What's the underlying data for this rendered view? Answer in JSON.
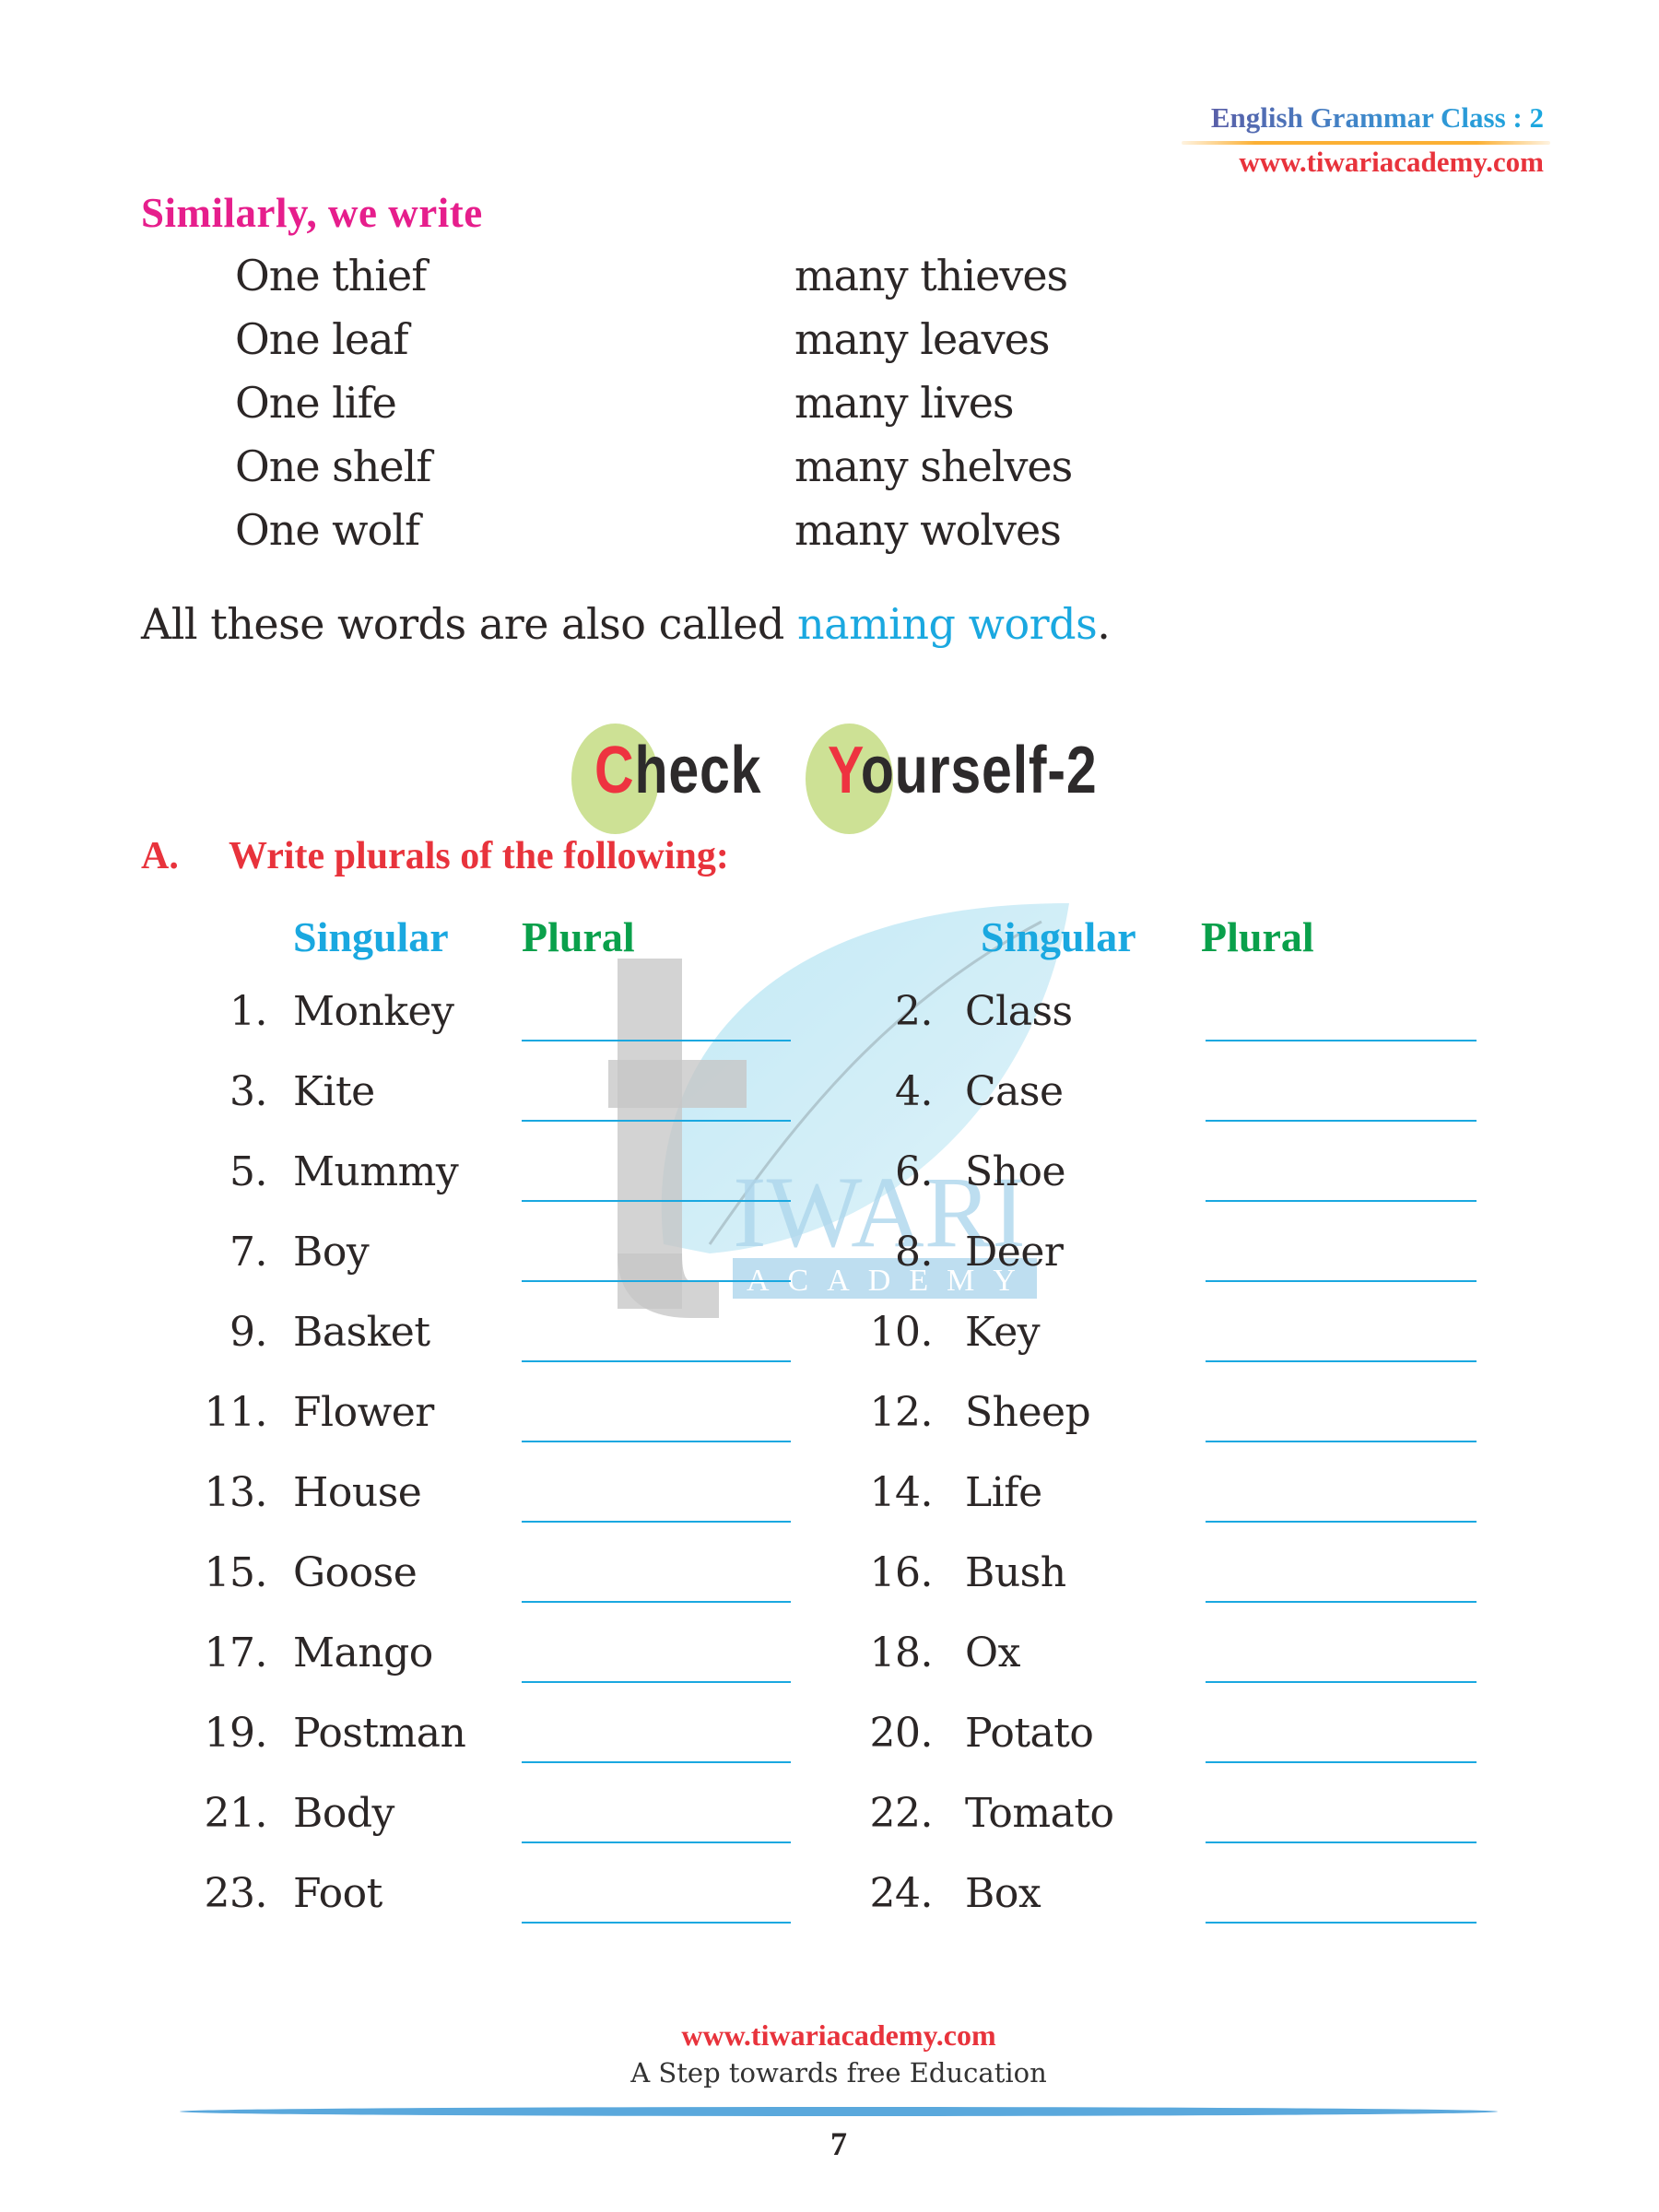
{
  "header": {
    "title": "English Grammar Class : 2",
    "url": "www.tiwariacademy.com"
  },
  "similarly": {
    "heading": "Similarly, we write",
    "pairs": [
      {
        "singular": "One thief",
        "plural": "many thieves"
      },
      {
        "singular": "One leaf",
        "plural": "many leaves"
      },
      {
        "singular": "One life",
        "plural": "many lives"
      },
      {
        "singular": "One shelf",
        "plural": "many shelves"
      },
      {
        "singular": "One wolf",
        "plural": "many wolves"
      }
    ],
    "note_prefix": "All these words are also called ",
    "note_highlight": "naming words",
    "note_suffix": "."
  },
  "check_yourself": {
    "title_c": "C",
    "title_rest1": "heck",
    "title_y": "Y",
    "title_rest2": "ourself-2"
  },
  "exercise": {
    "label": "A.",
    "instruction": "Write plurals of the following:",
    "col_singular": "Singular",
    "col_plural": "Plural",
    "left_items": [
      {
        "num": "1.",
        "word": "Monkey"
      },
      {
        "num": "3.",
        "word": "Kite"
      },
      {
        "num": "5.",
        "word": "Mummy"
      },
      {
        "num": "7.",
        "word": "Boy"
      },
      {
        "num": "9.",
        "word": "Basket"
      },
      {
        "num": "11.",
        "word": "Flower"
      },
      {
        "num": "13.",
        "word": "House"
      },
      {
        "num": "15.",
        "word": "Goose"
      },
      {
        "num": "17.",
        "word": "Mango"
      },
      {
        "num": "19.",
        "word": "Postman"
      },
      {
        "num": "21.",
        "word": "Body"
      },
      {
        "num": "23.",
        "word": "Foot"
      }
    ],
    "right_items": [
      {
        "num": "2.",
        "word": "Class"
      },
      {
        "num": "4.",
        "word": "Case"
      },
      {
        "num": "6.",
        "word": "Shoe"
      },
      {
        "num": "8.",
        "word": "Deer"
      },
      {
        "num": "10.",
        "word": "Key"
      },
      {
        "num": "12.",
        "word": "Sheep"
      },
      {
        "num": "14.",
        "word": "Life"
      },
      {
        "num": "16.",
        "word": "Bush"
      },
      {
        "num": "18.",
        "word": "Ox"
      },
      {
        "num": "20.",
        "word": "Potato"
      },
      {
        "num": "22.",
        "word": "Tomato"
      },
      {
        "num": "24.",
        "word": "Box"
      }
    ]
  },
  "watermark": {
    "text_main": "IWARI",
    "text_sub": "ACADEMY"
  },
  "footer": {
    "url": "www.tiwariacademy.com",
    "tagline": "A Step towards free Education",
    "page_number": "7"
  },
  "colors": {
    "pink": "#e61e8c",
    "red": "#e8333c",
    "blue": "#1aa8e0",
    "green": "#0aa04b",
    "circle": "#cde195"
  }
}
